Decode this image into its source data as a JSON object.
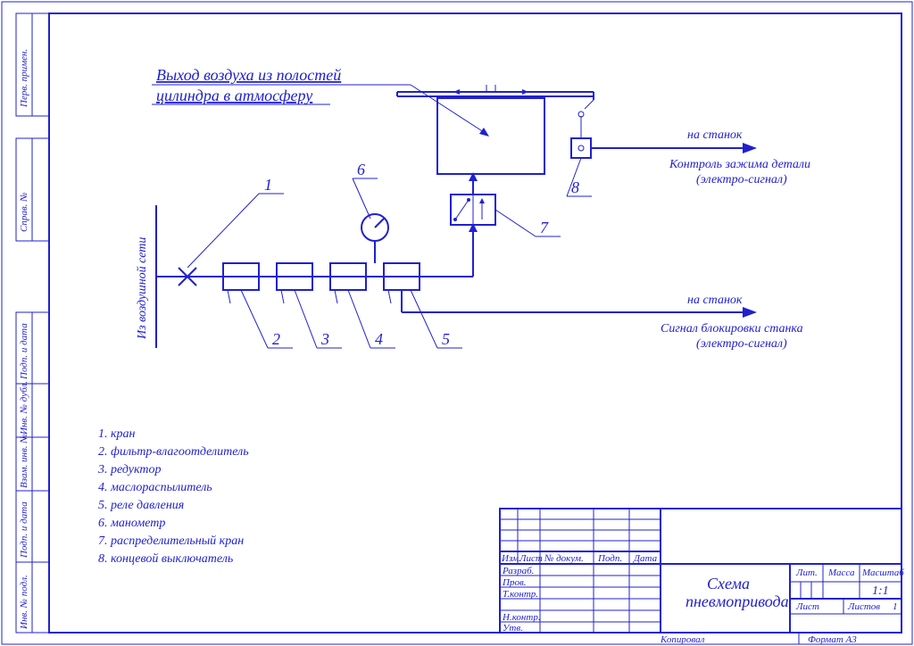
{
  "note_top": {
    "line1": "Выход воздуха из полостей",
    "line2": "цилиндра в атмосферу"
  },
  "inlet_label": "Из воздушной сети",
  "output1": {
    "dest": "на станок",
    "line1": "Контроль зажима детали",
    "line2": "(электро-сигнал)"
  },
  "output2": {
    "dest": "на станок",
    "line1": "Сигнал блокировки станка",
    "line2": "(электро-сигнал)"
  },
  "callouts": {
    "c1": "1",
    "c2": "2",
    "c3": "3",
    "c4": "4",
    "c5": "5",
    "c6": "6",
    "c7": "7",
    "c8": "8"
  },
  "legend": {
    "l1": "1. кран",
    "l2": "2. фильтр-влагоотделитель",
    "l3": "3. редуктор",
    "l4": "4. маслораспылитель",
    "l5": "5. реле давления",
    "l6": "6. манометр",
    "l7": "7. распределительный кран",
    "l8": "8. концевой выключатель"
  },
  "titleblock": {
    "title1": "Схема",
    "title2": "пневмопривода",
    "headers": {
      "izm": "Изм.",
      "list": "Лист",
      "ndoc": "№ докум.",
      "podp": "Подп.",
      "data": "Дата",
      "razrab": "Разраб.",
      "prov": "Пров.",
      "tkontr": "Т.контр.",
      "nkontr": "Н.контр.",
      "utv": "Утв.",
      "lit": "Лит.",
      "massa": "Масса",
      "mashtab": "Масштаб",
      "list2": "Лист",
      "listov": "Листов",
      "listov_val": "1",
      "scale": "1:1"
    },
    "kopiroval": "Копировал",
    "format": "Формат    А3"
  },
  "sidebar": {
    "s1": "Перв. примен.",
    "s2": "Справ. №",
    "s3": "Подп. и дата",
    "s4": "Инв. № дубл.",
    "s5": "Взам. инв. №",
    "s6": "Подп. и дата",
    "s7": "Инв. № подл."
  }
}
